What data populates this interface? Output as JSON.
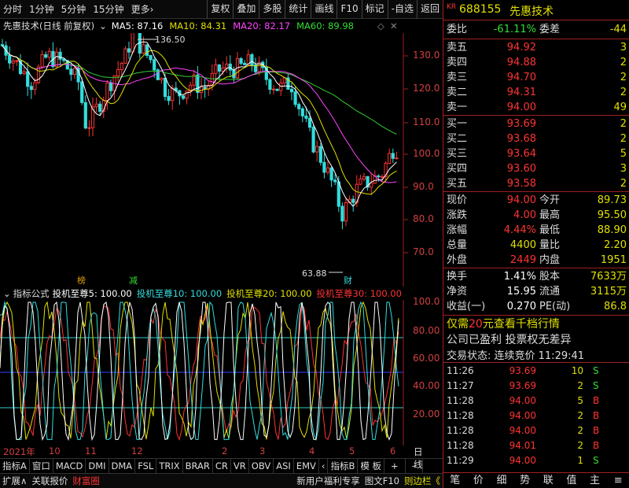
{
  "toolbar": {
    "left": [
      "分时",
      "1分钟",
      "5分钟",
      "15分钟",
      "更多›"
    ],
    "right": [
      "复权",
      "叠加",
      "多股",
      "统计",
      "画线",
      "F10",
      "标记",
      "-自选",
      "返回"
    ]
  },
  "info": {
    "name": "先惠技术",
    "period": "(日线 前复权)",
    "ma5": "MA5: 87.16",
    "ma10": "MA10: 84.31",
    "ma20": "MA20: 82.17",
    "ma60": "MA60: 89.98"
  },
  "price_axis": [
    "130.0",
    "120.0",
    "110.0",
    "100.0",
    "90.0",
    "80.0",
    "70.0"
  ],
  "annotations": {
    "high": "136.50",
    "low": "63.88",
    "tag_bang": "榜",
    "tag_jian": "减",
    "tag_cai": "财"
  },
  "indicator": {
    "title": "指标公式",
    "name": "投机至尊5: 100.00",
    "s10": "投机至尊10: 100.00",
    "s20": "投机至尊20: 100.00",
    "s30": "投机至尊30: 100.00",
    "axis": [
      "100.0",
      "80.00",
      "60.00",
      "40.00",
      "20.00"
    ]
  },
  "timeline": {
    "labels": [
      "2021年",
      "10",
      "11",
      "12",
      "2",
      "3",
      "4",
      "5",
      "6"
    ],
    "right": "日线"
  },
  "tabs": [
    "指标A",
    "窗口",
    "MACD",
    "DMI",
    "DMA",
    "FSL",
    "TRIX",
    "BRAR",
    "CR",
    "VR",
    "OBV",
    "ASI",
    "EMV",
    "‹",
    "指标B",
    "模 板",
    "+",
    "–"
  ],
  "status": {
    "left": [
      "扩展∧",
      "关联报价",
      "财富圈"
    ],
    "right": [
      "新用户福利专享",
      "图文F10",
      "则边栏《"
    ]
  },
  "quote": {
    "code": "688155",
    "name": "先惠技术",
    "kr": "KR",
    "weibi_label": "委比",
    "weibi": "-61.11%",
    "weicha_label": "委差",
    "weicha": "-44",
    "asks": [
      {
        "l": "卖五",
        "p": "94.92",
        "v": "3"
      },
      {
        "l": "卖四",
        "p": "94.88",
        "v": "2"
      },
      {
        "l": "卖三",
        "p": "94.70",
        "v": "2"
      },
      {
        "l": "卖二",
        "p": "94.31",
        "v": "2"
      },
      {
        "l": "卖一",
        "p": "94.00",
        "v": "49"
      }
    ],
    "bids": [
      {
        "l": "买一",
        "p": "93.69",
        "v": "2"
      },
      {
        "l": "买二",
        "p": "93.68",
        "v": "2"
      },
      {
        "l": "买三",
        "p": "93.64",
        "v": "5"
      },
      {
        "l": "买四",
        "p": "93.60",
        "v": "3"
      },
      {
        "l": "买五",
        "p": "93.58",
        "v": "2"
      }
    ],
    "stats": [
      {
        "a": "现价",
        "av": "94.00",
        "b": "今开",
        "bv": "89.73"
      },
      {
        "a": "涨跌",
        "av": "4.00",
        "b": "最高",
        "bv": "95.50"
      },
      {
        "a": "涨幅",
        "av": "4.44%",
        "b": "最低",
        "bv": "88.90"
      },
      {
        "a": "总量",
        "av": "4400",
        "b": "量比",
        "bv": "2.20"
      },
      {
        "a": "外盘",
        "av": "2449",
        "b": "内盘",
        "bv": "1951"
      }
    ],
    "stats2": [
      {
        "a": "换手",
        "av": "1.41%",
        "b": "股本",
        "bv": "7633万"
      },
      {
        "a": "净资",
        "av": "15.95",
        "b": "流通",
        "bv": "3115万"
      },
      {
        "a": "收益(一)",
        "av": "0.270",
        "b": "PE(动)",
        "bv": "86.8"
      }
    ],
    "promo": "仅需20元查看千档行情",
    "promo_pre": "仅需",
    "promo_num": "20",
    "promo_post": "元查看千档行情",
    "notice": "公司已盈利 投票权无差异",
    "trade_state": "交易状态: 连续竞价 11:29:41",
    "ticks": [
      {
        "t": "11:26",
        "p": "93.69",
        "v": "10",
        "d": "S"
      },
      {
        "t": "11:27",
        "p": "93.69",
        "v": "2",
        "d": "S"
      },
      {
        "t": "11:28",
        "p": "94.00",
        "v": "5",
        "d": "B"
      },
      {
        "t": "11:28",
        "p": "94.00",
        "v": "2",
        "d": "B"
      },
      {
        "t": "11:28",
        "p": "94.00",
        "v": "2",
        "d": "B"
      },
      {
        "t": "11:28",
        "p": "94.01",
        "v": "2",
        "d": "B"
      },
      {
        "t": "11:29",
        "p": "94.00",
        "v": "1",
        "d": "S"
      }
    ],
    "bottom_tabs": [
      "笔",
      "价",
      "细",
      "势",
      "联",
      "值",
      "主",
      "≡"
    ]
  }
}
